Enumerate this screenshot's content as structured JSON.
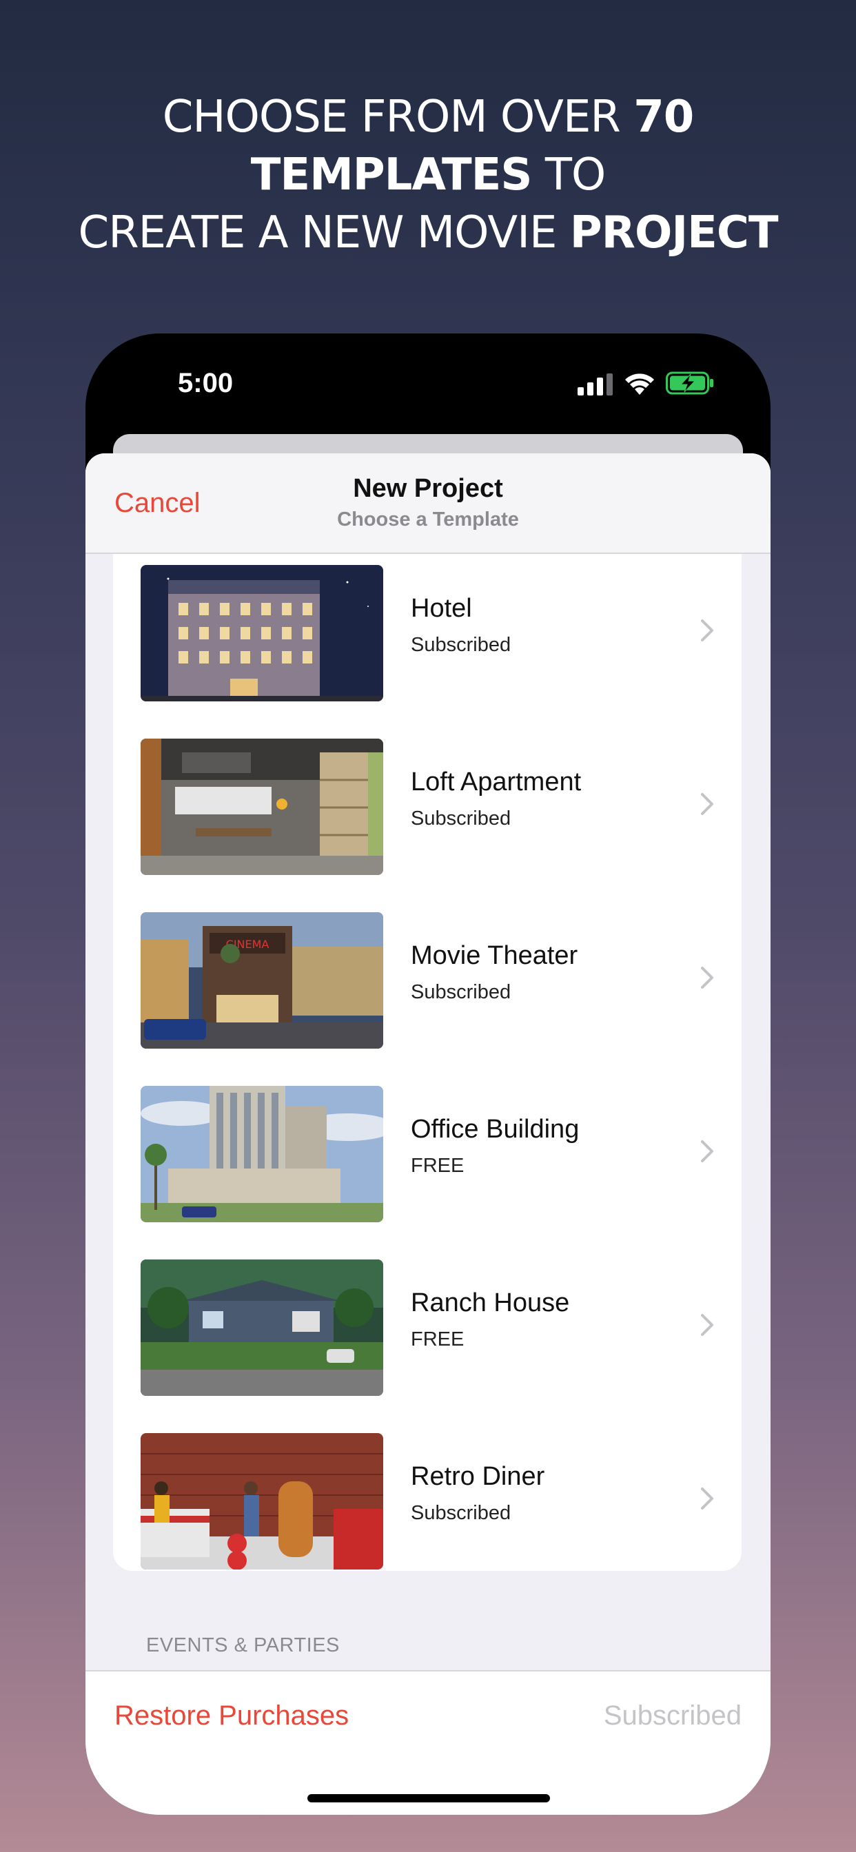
{
  "headline": {
    "line1_pre": "CHOOSE FROM OVER ",
    "line1_bold": "70",
    "line2_bold": "TEMPLATES",
    "line2_post": " TO",
    "line3_pre": "CREATE A NEW MOVIE ",
    "line3_bold": "PROJECT"
  },
  "status_bar": {
    "time": "5:00"
  },
  "nav": {
    "cancel_label": "Cancel",
    "title": "New Project",
    "subtitle": "Choose a Template"
  },
  "templates": [
    {
      "title": "Hotel",
      "status": "Subscribed",
      "thumbnail": "hotel-facade-night"
    },
    {
      "title": "Loft Apartment",
      "status": "Subscribed",
      "thumbnail": "loft-interior"
    },
    {
      "title": "Movie Theater",
      "status": "Subscribed",
      "thumbnail": "cinema-street"
    },
    {
      "title": "Office Building",
      "status": "FREE",
      "thumbnail": "office-tower"
    },
    {
      "title": "Ranch House",
      "status": "FREE",
      "thumbnail": "ranch-house-lawn"
    },
    {
      "title": "Retro Diner",
      "status": "Subscribed",
      "thumbnail": "diner-interior"
    }
  ],
  "section_header": "EVENTS & PARTIES",
  "toolbar": {
    "restore_label": "Restore Purchases",
    "subscription_status": "Subscribed"
  },
  "colors": {
    "accent": "#e8483a",
    "disabled_text": "#c4c4c8",
    "battery": "#34c759"
  }
}
